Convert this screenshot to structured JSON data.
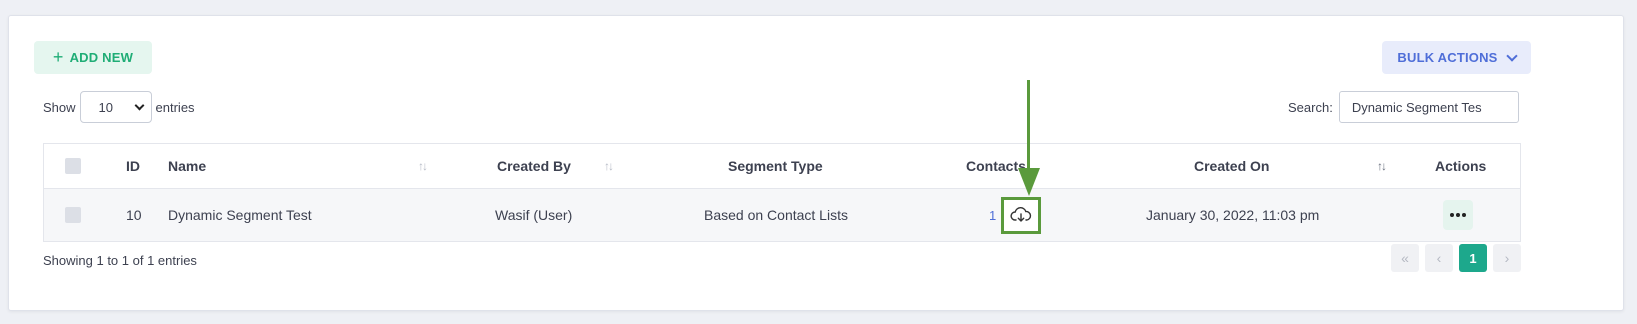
{
  "toolbar": {
    "add_new_label": "ADD NEW",
    "bulk_actions_label": "BULK ACTIONS"
  },
  "length_control": {
    "show_label": "Show",
    "selected_value": "10",
    "entries_label": "entries"
  },
  "search": {
    "label": "Search:",
    "value": "Dynamic Segment Tes"
  },
  "table": {
    "columns": [
      "ID",
      "Name",
      "Created By",
      "Segment Type",
      "Contacts",
      "Created On",
      "Actions"
    ],
    "rows": [
      {
        "id": "10",
        "name": "Dynamic Segment Test",
        "created_by": "Wasif (User)",
        "segment_type": "Based on Contact Lists",
        "contacts": "1",
        "created_on": "January 30, 2022, 11:03 pm"
      }
    ]
  },
  "footer": {
    "info": "Showing 1 to 1 of 1 entries",
    "pagination": {
      "first": "«",
      "prev": "‹",
      "current_page": "1",
      "next": "›",
      "last": "»"
    }
  },
  "icons": {
    "add": "plus-icon",
    "bulk": "chevron-down-icon",
    "download": "cloud-download-icon",
    "actions": "ellipsis-icon",
    "annotation": "arrow-down-icon"
  },
  "colors": {
    "accent_green": "#1fad76",
    "accent_blue": "#4f6ed8",
    "page_active": "#1da88c",
    "highlight": "#5a9a3c"
  }
}
